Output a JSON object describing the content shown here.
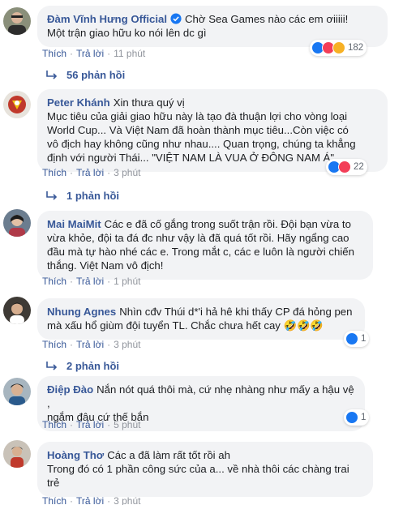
{
  "comments": [
    {
      "author": "Đàm Vĩnh Hưng Official",
      "verified": true,
      "text": "Chờ Sea Games nào các em ơiiiii!\nMột trận giao hữu ko nói lên dc gì",
      "like": "Thích",
      "reply": "Trả lời",
      "time": "11 phút",
      "reaction_count": "182",
      "reactions": [
        "like-icon",
        "love-icon",
        "haha-icon"
      ],
      "replies_label": "56 phản hồi"
    },
    {
      "author": "Peter Khánh",
      "verified": false,
      "text": "Xin thưa quý vị\nMục tiêu của giải giao hữu này là tạo đà thuận lợi cho vòng loại\nWorld Cup... Và Việt Nam đã hoàn thành mục tiêu...Còn việc có\nvô địch hay không cũng như nhau.... Quan trọng, chúng ta khẳng\nđịnh với người Thái... \"VIỆT NAM LÀ VUA Ở ĐÔNG NAM Á\"",
      "like": "Thích",
      "reply": "Trả lời",
      "time": "3 phút",
      "reaction_count": "22",
      "reactions": [
        "like-icon",
        "love-icon"
      ],
      "replies_label": "1 phản hồi"
    },
    {
      "author": "Mai MaiMit",
      "verified": false,
      "text": "Các e đã cố gắng trong suốt trận rồi. Đội bạn vừa to\nvừa khỏe, đội ta đá đc như vậy là đã quá tốt rồi. Hãy ngẩng cao\nđầu mà tự hào nhé các e. Trong mắt c, các e luôn là người chiến\nthắng. Việt Nam vô địch!",
      "like": "Thích",
      "reply": "Trả lời",
      "time": "1 phút"
    },
    {
      "author": "Nhung Agnes",
      "verified": false,
      "text": "Nhìn cđv Thúi d*'i hả hê khi thấy CP đá hỏng pen\nmà xấu hổ giùm đội tuyển TL. Chắc chưa hết cay 🤣🤣🤣",
      "like": "Thích",
      "reply": "Trả lời",
      "time": "3 phút",
      "reaction_count": "1",
      "reactions": [
        "like-icon"
      ],
      "replies_label": "2 phản hồi"
    },
    {
      "author": "Điệp Đào",
      "verified": false,
      "text": "Nắn nót quá thôi mà, cứ nhẹ nhàng như mấy a hậu vệ ,\nngắm đâu cứ thế bắn",
      "like": "Thích",
      "reply": "Trả lời",
      "time": "5 phút",
      "reaction_count": "1",
      "reactions": [
        "like-icon"
      ]
    },
    {
      "author": "Hoàng Thơ",
      "verified": false,
      "text": "Các a đã làm rất tốt rồi ah\nTrong đó có 1 phần công sức của a... về nhà thôi các chàng trai\ntrẻ",
      "like": "Thích",
      "reply": "Trả lời",
      "time": "3 phút"
    }
  ],
  "colors": {
    "link": "#385898",
    "bubble": "#f2f3f5",
    "like_blue": "#1877f2",
    "love_red": "#f33e58",
    "haha_yellow": "#f7b125"
  }
}
